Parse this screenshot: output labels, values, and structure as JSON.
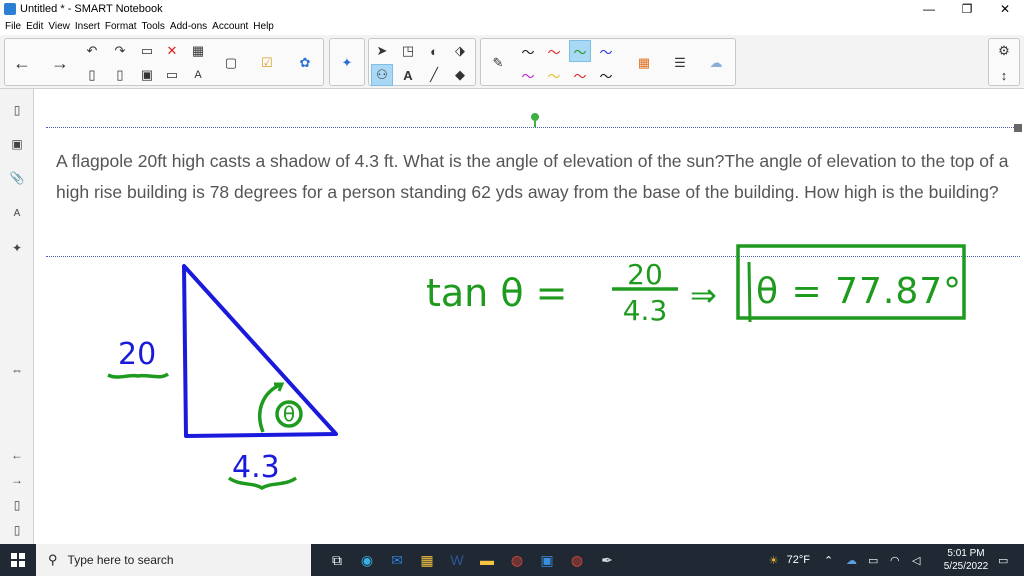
{
  "window": {
    "title": "Untitled * - SMART Notebook",
    "controls": [
      "—",
      "❐",
      "✕"
    ]
  },
  "menu": [
    "File",
    "Edit",
    "View",
    "Insert",
    "Format",
    "Tools",
    "Add-ons",
    "Account",
    "Help"
  ],
  "question": "A flagpole 20ft high casts a shadow of 4.3 ft. What is the angle of elevation of the sun?The angle of elevation to the top of a high rise building is 78 degrees for a person standing 62 yds away from the base of the building. How high is the building?",
  "ink": {
    "height_label": "20",
    "base_label": "4.3",
    "angle_label": "θ",
    "equation_lhs": "tan θ =",
    "numerator": "20",
    "denominator": "4.3",
    "implies": "⇒",
    "answer": "θ = 77.87°",
    "colors": {
      "blue": "#1a1adc",
      "green": "#1e9a1e"
    }
  },
  "taskbar": {
    "search_placeholder": "Type here to search",
    "weather": "72°F",
    "time": "5:01 PM",
    "date": "5/25/2022"
  }
}
